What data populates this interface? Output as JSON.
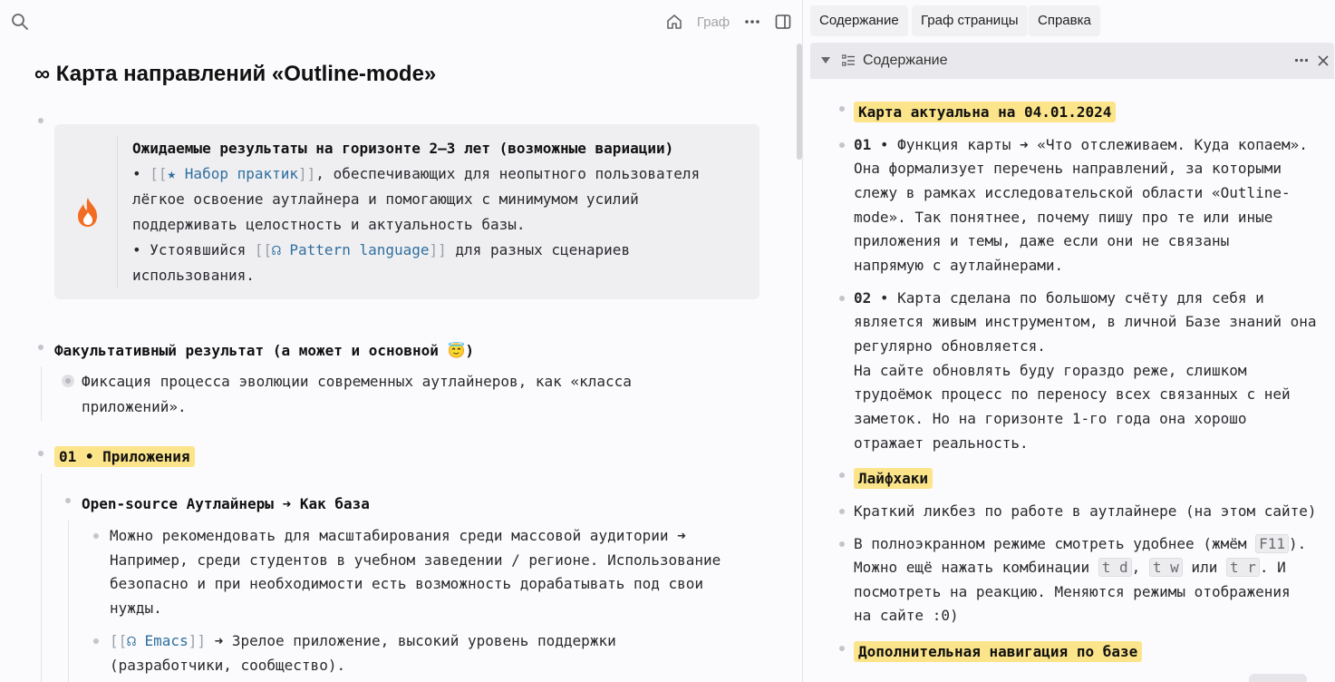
{
  "toolbar": {
    "graph_label": "Граф"
  },
  "page": {
    "title": "∞ Карта направлений «Outline-mode»"
  },
  "callout": {
    "heading": "Ожидаемые результаты на горизонте 2–3 лет (возможные вариации)",
    "line1_pre": "• ",
    "line1_link": "★ Набор практик",
    "line1_post": ", обеспечивающих для неопытного пользователя",
    "line2": "лёгкое освоение аутлайнера и помогающих с минимумом усилий",
    "line3": "поддерживать целостность и актуальность базы.",
    "line4_pre": "• Устоявшийся ",
    "line4_link": "☊ Pattern language",
    "line4_post": " для разных сценариев",
    "line5": "использования."
  },
  "outline": {
    "optional_heading": "Факультативный результат (а может и основной 😇)",
    "fixation_line1": "Фиксация процесса эволюции современных аутлайнеров, как «класса",
    "fixation_line2": "приложений».",
    "apps_heading": "01 • Приложения",
    "opensource_heading": "Open-source Аутлайнеры ➜ Как база",
    "recommend_line1": "Можно рекомендовать для масштабирования среди массовой аудитории ➜",
    "recommend_line2": "Например, среди студентов в учебном заведении / регионе. Использование",
    "recommend_line3": "безопасно и при необходимости есть возможность дорабатывать под свои",
    "recommend_line4": "нужды.",
    "emacs_link": "☊ Emacs",
    "emacs_post": " ➜ Зрелое приложение, высокий уровень поддержки",
    "emacs_line2": "(разработчики, сообщество)."
  },
  "right_tabs": [
    {
      "label": "Содержание"
    },
    {
      "label": "Граф страницы"
    },
    {
      "label": "Справка"
    }
  ],
  "toc": {
    "title": "Содержание",
    "actual": "Карта актуальна на 04.01.2024",
    "item01_num": "01",
    "item01_l1": " • Функция карты ➜ «Что отслеживаем. Куда копаем».",
    "item01_l2": "Она формализует перечень направлений, за которыми",
    "item01_l3": "слежу в рамках исследовательской области «Outline-",
    "item01_l4": "mode». Так понятнее, почему пишу про те или иные",
    "item01_l5": "приложения и темы, даже если они не связаны",
    "item01_l6": "напрямую с аутлайнерами.",
    "item02_num": "02",
    "item02_l1": " • Карта сделана по большому счёту для себя и",
    "item02_l2": "является живым инструментом, в личной Базе знаний она",
    "item02_l3": "регулярно обновляется.",
    "item02_l4": "На сайте обновлять буду гораздо реже, слишком",
    "item02_l5": "трудоёмок процесс по переносу всех связанных с ней",
    "item02_l6": "заметок. Но на горизонте 1-го года она хорошо",
    "item02_l7": "отражает реальность.",
    "lifehacks": "Лайфхаки",
    "guide_link": "Краткий ликбез по работе в аутлайнере (на этом сайте)",
    "fs_l1_pre": "В полноэкранном режиме смотреть удобнее (жмём ",
    "fs_key": "F11",
    "fs_l1_post": ").",
    "fs_l2_pre": "Можно ещё нажать комбинации ",
    "key_td": "t d",
    "key_tw": "t w",
    "fs_l2_mid": " или ",
    "key_tr": "t r",
    "fs_l2_post": ". И",
    "fs_l3": "посмотреть на реакцию. Меняются режимы отображения",
    "fs_l4": "на сайте :0)",
    "extra_nav": "Дополнительная навигация по базе"
  }
}
